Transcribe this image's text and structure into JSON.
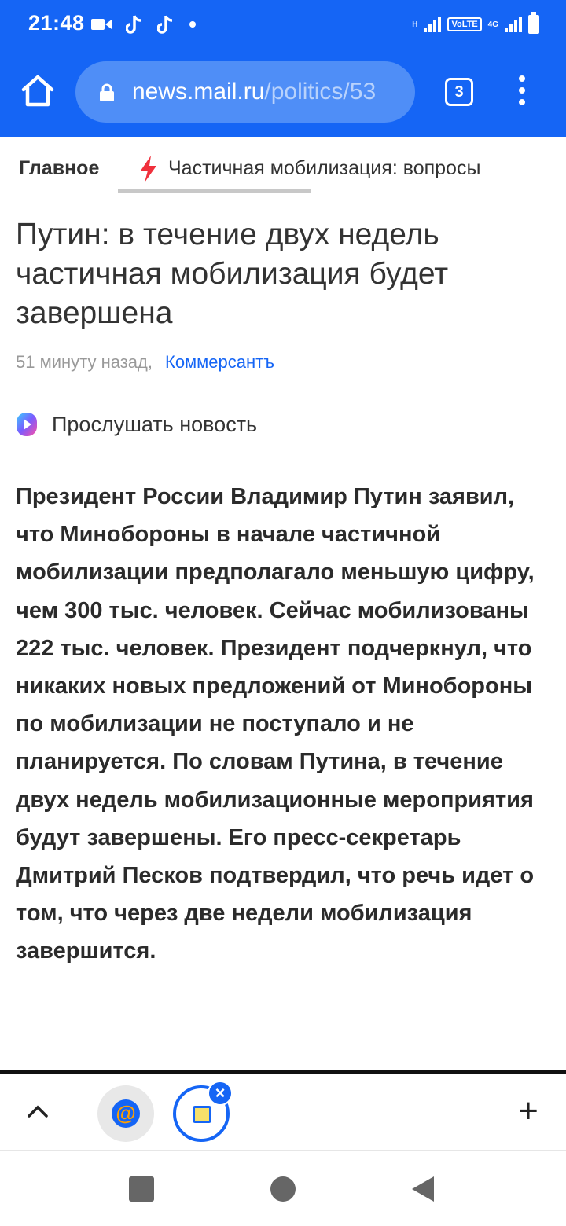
{
  "status_bar": {
    "time": "21:48",
    "left_icons": [
      "video-camera-icon",
      "tiktok-icon",
      "tiktok-icon",
      "notification-dot-icon"
    ],
    "network_h": "H",
    "volte": "VoLTE",
    "network_4g": "4G",
    "battery": "battery-full-icon"
  },
  "browser": {
    "home_icon": "home-icon",
    "url_host": "news.mail.ru",
    "url_path": "/politics/53",
    "tab_count": "3",
    "menu_icon": "more-vertical-icon",
    "theme_color": "#1565f5"
  },
  "section_nav": {
    "home_label": "Главное",
    "topic_icon": "lightning-icon",
    "topic_label": "Частичная мобилизация: вопросы"
  },
  "article": {
    "headline": "Путин: в течение двух недель частичная мобилизация будет завершена",
    "time_ago": "51 минуту назад,",
    "source": "Коммерсантъ",
    "listen_label": "Прослушать новость",
    "body": "Президент России Владимир Путин заявил, что Минобороны в начале частичной мобилизации предполагало меньшую цифру, чем 300 тыс. человек. Сейчас мобилизованы 222 тыс. человек. Президент подчеркнул, что никаких новых предложений от Минобороны по мобилизации не поступало и не планируется. По словам Путина, в течение двух недель мобилизационные мероприятия будут завершены. Его пресс-секретарь Дмитрий Песков подтвердил, что речь идет о том, что через две недели мобилизация завершится."
  },
  "tab_strip": {
    "expand_icon": "chevron-up-icon",
    "tabs": [
      {
        "icon": "mail-ru-icon",
        "glyph": "@"
      },
      {
        "icon": "news-tab-icon",
        "close": "×"
      }
    ],
    "new_tab": "+"
  },
  "system_nav": {
    "buttons": [
      "recents-icon",
      "home-circle-icon",
      "back-icon"
    ]
  }
}
